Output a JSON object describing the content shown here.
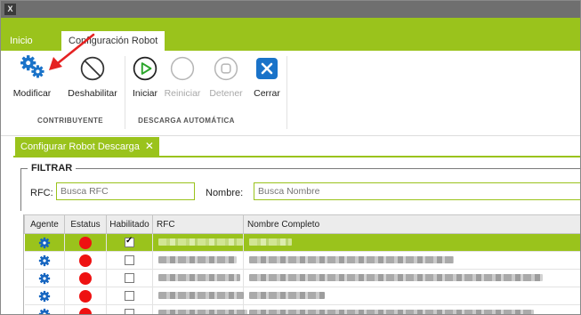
{
  "app": {
    "icon_glyph": "X"
  },
  "top_tabs": [
    {
      "label": "Inicio",
      "active": false
    },
    {
      "label": "Configuración Robot",
      "active": true
    }
  ],
  "ribbon": {
    "buttons": [
      {
        "label": "Modificar",
        "icon": "gears-icon",
        "enabled": true
      },
      {
        "label": "Deshabilitar",
        "icon": "prohibited-icon",
        "enabled": true
      },
      {
        "label": "Iniciar",
        "icon": "play-icon",
        "enabled": true
      },
      {
        "label": "Reiniciar",
        "icon": "restart-icon",
        "enabled": false
      },
      {
        "label": "Detener",
        "icon": "stop-icon",
        "enabled": false
      },
      {
        "label": "Cerrar",
        "icon": "close-icon",
        "enabled": true
      }
    ],
    "groups": [
      {
        "label": "CONTRIBUYENTE"
      },
      {
        "label": "DESCARGA AUTOMÁTICA"
      }
    ]
  },
  "document_tab": {
    "label": "Configurar Robot Descarga",
    "close_glyph": "✕"
  },
  "filter": {
    "title": "FILTRAR",
    "rfc_label": "RFC:",
    "rfc_placeholder": "Busca RFC",
    "nombre_label": "Nombre:",
    "nombre_placeholder": "Busca Nombre"
  },
  "grid": {
    "columns": [
      "Agente",
      "Estatus",
      "Habilitado",
      "RFC",
      "Nombre Completo"
    ],
    "rows": [
      {
        "selected": true,
        "status_color": "#ee1111",
        "habilitado": true
      },
      {
        "selected": false,
        "status_color": "#ee1111",
        "habilitado": false
      },
      {
        "selected": false,
        "status_color": "#ee1111",
        "habilitado": false
      },
      {
        "selected": false,
        "status_color": "#ee1111",
        "habilitado": false
      },
      {
        "selected": false,
        "status_color": "#ee1111",
        "habilitado": false
      }
    ]
  },
  "colors": {
    "accent": "#9ac31c",
    "gear_blue": "#1565c0",
    "status_red": "#ee1111",
    "annotation_arrow": "#e52222"
  }
}
